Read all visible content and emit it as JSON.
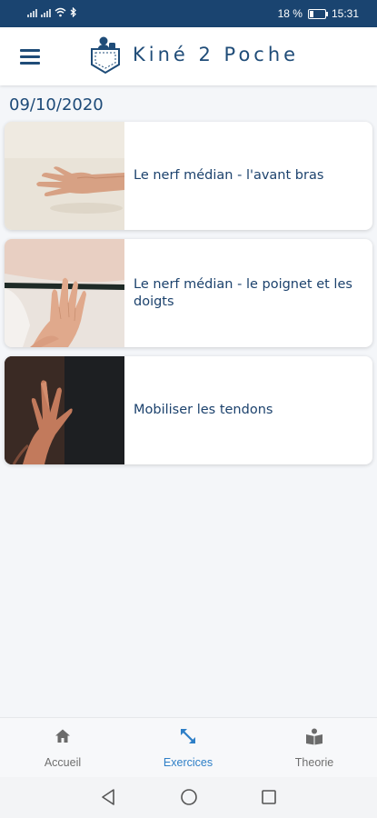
{
  "status_bar": {
    "battery": "18 %",
    "time": "15:31"
  },
  "app_bar": {
    "title": "Kiné 2 Poche",
    "menu_icon": "hamburger-menu-icon",
    "logo_icon": "pocket-logo-icon"
  },
  "date": "09/10/2020",
  "exercises": [
    {
      "title": "Le nerf médian - l'avant bras",
      "image": "hand-on-table-photo"
    },
    {
      "title": "Le nerf médian - le poignet et les doigts",
      "image": "hand-on-wall-photo"
    },
    {
      "title": "Mobiliser les tendons",
      "image": "hands-dark-background-photo"
    }
  ],
  "bottom_nav": {
    "items": [
      {
        "label": "Accueil",
        "icon": "home-icon",
        "active": false
      },
      {
        "label": "Exercices",
        "icon": "exercise-arrows-icon",
        "active": true
      },
      {
        "label": "Theorie",
        "icon": "book-reader-icon",
        "active": false
      }
    ]
  },
  "colors": {
    "status_bar": "#1a4470",
    "primary": "#1f4c78",
    "active_tab": "#2e7fc7",
    "inactive_tab": "#6f6f6f",
    "background": "#f4f6f9"
  }
}
